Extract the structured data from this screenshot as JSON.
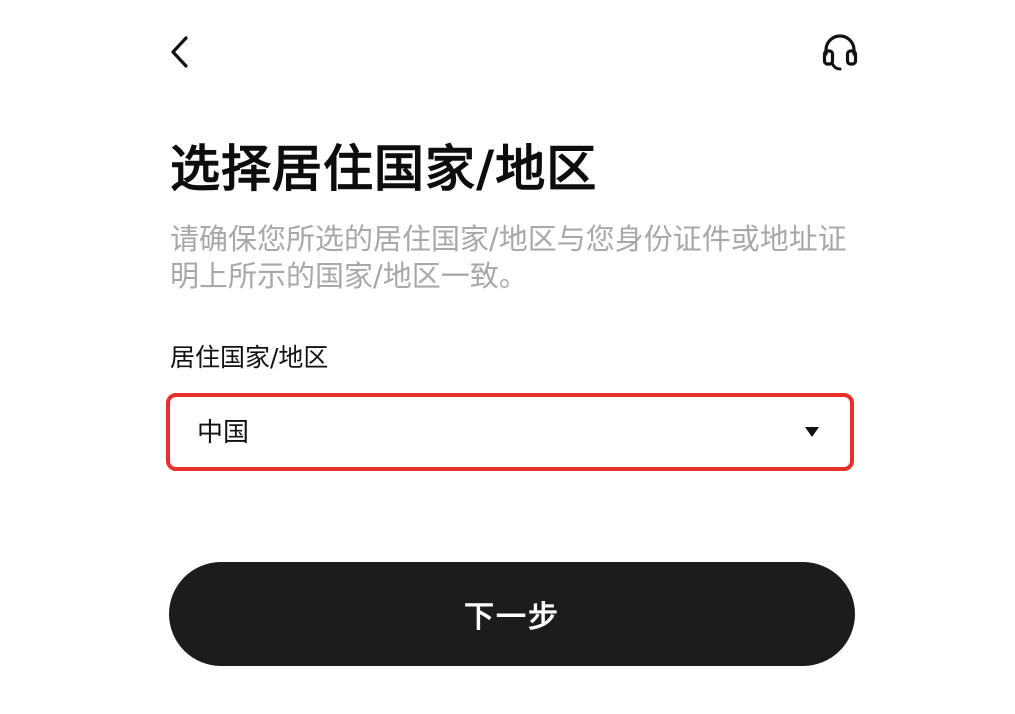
{
  "header": {
    "back_icon": "chevron-left-icon",
    "support_icon": "headset-icon"
  },
  "page": {
    "title": "选择居住国家/地区",
    "subtitle": "请确保您所选的居住国家/地区与您身份证件或地址证明上所示的国家/地区一致。"
  },
  "form": {
    "country_label": "居住国家/地区",
    "country_value": "中国",
    "caret_icon": "caret-down-icon",
    "highlight_color": "#e8302a"
  },
  "actions": {
    "next_label": "下一步"
  }
}
